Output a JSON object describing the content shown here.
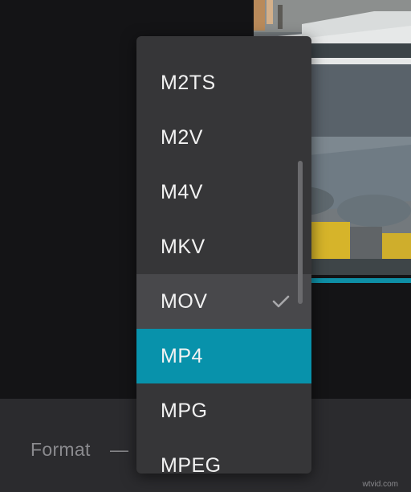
{
  "format_panel": {
    "label": "Format",
    "dash": "—"
  },
  "dropdown": {
    "options": [
      {
        "label": "M2TS",
        "state": "normal"
      },
      {
        "label": "M2V",
        "state": "normal"
      },
      {
        "label": "M4V",
        "state": "normal"
      },
      {
        "label": "MKV",
        "state": "normal"
      },
      {
        "label": "MOV",
        "state": "hovered",
        "checked": true
      },
      {
        "label": "MP4",
        "state": "selected"
      },
      {
        "label": "MPG",
        "state": "normal"
      },
      {
        "label": "MPEG",
        "state": "normal"
      }
    ]
  },
  "watermark": "wtvid.com",
  "colors": {
    "accent": "#0892ab",
    "menu_bg": "#363638",
    "hover_bg": "#48484b",
    "app_bg": "#141416",
    "panel_bg": "#2b2b2e"
  }
}
